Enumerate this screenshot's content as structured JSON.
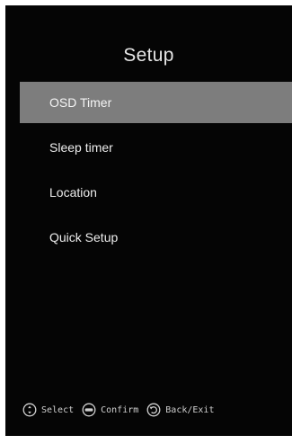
{
  "screen": {
    "title": "Setup"
  },
  "menu": {
    "items": [
      {
        "label": "OSD Timer",
        "selected": true
      },
      {
        "label": "Sleep timer",
        "selected": false
      },
      {
        "label": "Location",
        "selected": false
      },
      {
        "label": "Quick Setup",
        "selected": false
      }
    ]
  },
  "footer": {
    "hints": [
      {
        "icon": "dpad-icon",
        "label": "Select"
      },
      {
        "icon": "enter-button-icon",
        "label": "Confirm"
      },
      {
        "icon": "back-arrow-icon",
        "label": "Back/Exit"
      }
    ]
  },
  "colors": {
    "background": "#050505",
    "selected_row": "#7d7d7d",
    "text": "#ededed"
  }
}
